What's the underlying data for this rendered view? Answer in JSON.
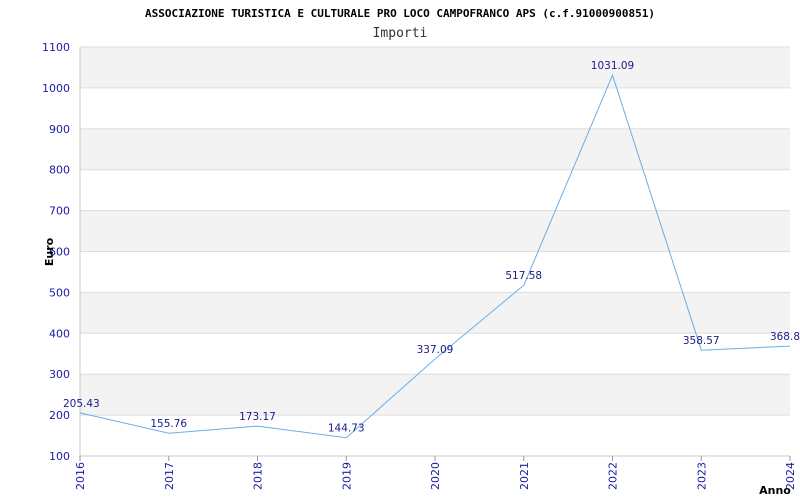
{
  "chart_data": {
    "type": "line",
    "title": "ASSOCIAZIONE TURISTICA E CULTURALE PRO LOCO CAMPOFRANCO APS (c.f.91000900851)",
    "subtitle": "Importi",
    "xlabel": "Anno",
    "ylabel": "Euro",
    "ylim": [
      100,
      1100
    ],
    "yticks": [
      "100",
      "200",
      "300",
      "400",
      "500",
      "600",
      "700",
      "800",
      "900",
      "1000",
      "1100"
    ],
    "grid": true,
    "x": [
      "2016",
      "2017",
      "2018",
      "2019",
      "2020",
      "2021",
      "2022",
      "2023",
      "2024"
    ],
    "values": [
      205.43,
      155.76,
      173.17,
      144.73,
      337.09,
      517.58,
      1031.09,
      358.57,
      368.8
    ],
    "labels": [
      "205.43",
      "155.76",
      "173.17",
      "144.73",
      "337.09",
      "517.58",
      "1031.09",
      "358.57",
      "368.8"
    ],
    "colors": {
      "line": "#6aaee8",
      "band": "#f3f3f3",
      "grid": "#dddddd",
      "tick": "#1a1aa6"
    }
  }
}
